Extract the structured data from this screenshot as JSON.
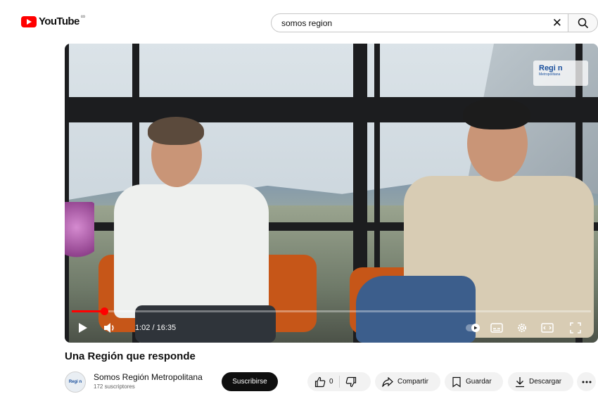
{
  "header": {
    "logo_text": "YouTube",
    "logo_sup": "∞",
    "search_value": "somos region"
  },
  "watermark": {
    "title": "Regi  n",
    "subtitle": "Metropolitana"
  },
  "player": {
    "time": "1:02 / 16:35",
    "progress_fraction": 0.063
  },
  "video": {
    "title": "Una Región que responde"
  },
  "channel": {
    "avatar_text": "Regi n",
    "name": "Somos Región Metropolitana",
    "subscribers": "172 suscriptores",
    "subscribe_label": "Suscribirse"
  },
  "actions": {
    "like_count": "0",
    "share_label": "Compartir",
    "save_label": "Guardar",
    "download_label": "Descargar"
  },
  "colors": {
    "brand_red": "#ff0000",
    "watermark_blue": "#1a4f9c"
  }
}
